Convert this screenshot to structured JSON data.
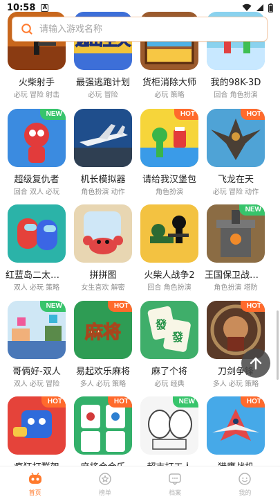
{
  "status_bar": {
    "time": "10:58",
    "notification_letter": "A"
  },
  "search": {
    "placeholder": "请输入游戏名称"
  },
  "colors": {
    "accent": "#ff7a2d",
    "badge_new": "#37c46b",
    "badge_hot": "#ff6a2c",
    "tag_text": "#8e8e8e"
  },
  "games": [
    {
      "name": "火柴射手",
      "tags": "必玩 冒险 射击",
      "badge": "",
      "art": "shooter"
    },
    {
      "name": "最强逃跑计划",
      "tags": "必玩 冒险",
      "badge": "",
      "art": "escape"
    },
    {
      "name": "货柜消除大师",
      "tags": "必玩 策略",
      "badge": "",
      "art": "shelf"
    },
    {
      "name": "我的98K-3D",
      "tags": "回合 角色扮演",
      "badge": "",
      "art": "stick3d"
    },
    {
      "name": "超级复仇者",
      "tags": "回合 双人 必玩",
      "badge": "NEW",
      "art": "spider"
    },
    {
      "name": "机长模拟器",
      "tags": "角色扮演 动作",
      "badge": "",
      "art": "plane"
    },
    {
      "name": "请给我汉堡包",
      "tags": "角色扮演",
      "badge": "HOT",
      "art": "burger"
    },
    {
      "name": "飞龙在天",
      "tags": "必玩 冒险 动作",
      "badge": "HOT",
      "art": "dragon"
    },
    {
      "name": "红蓝岛二太空人",
      "tags": "双人 必玩 策略",
      "badge": "",
      "art": "amongus"
    },
    {
      "name": "拼拼图",
      "tags": "女生喜欢 解密",
      "badge": "",
      "art": "crab"
    },
    {
      "name": "火柴人战争2",
      "tags": "回合 角色扮演",
      "badge": "",
      "art": "stickwar"
    },
    {
      "name": "王国保卫战塔防",
      "tags": "角色扮演 塔防",
      "badge": "NEW",
      "art": "tower"
    },
    {
      "name": "哥俩好-双人",
      "tags": "双人 必玩 冒险",
      "badge": "NEW",
      "art": "bros"
    },
    {
      "name": "易起欢乐麻将",
      "tags": "多人 必玩 策略",
      "badge": "HOT",
      "art": "mahjong"
    },
    {
      "name": "麻了个将",
      "tags": "必玩 经典",
      "badge": "",
      "art": "mahjong2"
    },
    {
      "name": "刀剑争锋",
      "tags": "多人 必玩 策略",
      "badge": "HOT",
      "art": "warrior"
    },
    {
      "name": "疯狂打群架",
      "tags": "",
      "badge": "HOT",
      "art": "brawl"
    },
    {
      "name": "麻将合合乐",
      "tags": "",
      "badge": "HOT",
      "art": "tiles"
    },
    {
      "name": "超市打工人",
      "tags": "",
      "badge": "NEW",
      "art": "worker"
    },
    {
      "name": "猎鹰战机",
      "tags": "",
      "badge": "HOT",
      "art": "jet"
    }
  ],
  "tabbar": {
    "tabs": [
      {
        "label": "首页",
        "icon": "home-gamepad-icon",
        "active": true
      },
      {
        "label": "榜单",
        "icon": "ranking-icon",
        "active": false
      },
      {
        "label": "档案",
        "icon": "archive-chat-icon",
        "active": false
      },
      {
        "label": "我的",
        "icon": "profile-icon",
        "active": false
      }
    ]
  }
}
